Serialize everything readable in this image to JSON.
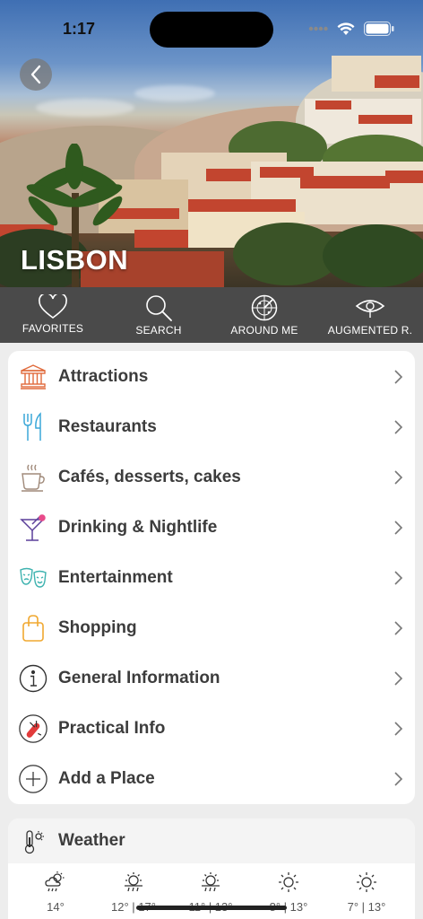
{
  "status": {
    "time": "1:17"
  },
  "hero": {
    "city": "LISBON"
  },
  "toolbar": {
    "items": [
      {
        "label": "FAVORITES",
        "icon": "heart-icon"
      },
      {
        "label": "SEARCH",
        "icon": "search-icon"
      },
      {
        "label": "AROUND ME",
        "icon": "radar-icon"
      },
      {
        "label": "AUGMENTED R.",
        "icon": "eye-icon"
      }
    ]
  },
  "menu": {
    "items": [
      {
        "label": "Attractions",
        "icon": "temple-icon",
        "color": "#e06a3b"
      },
      {
        "label": "Restaurants",
        "icon": "fork-knife-icon",
        "color": "#3aa7d8"
      },
      {
        "label": "Cafés, desserts, cakes",
        "icon": "coffee-cup-icon",
        "color": "#a08a7a"
      },
      {
        "label": "Drinking & Nightlife",
        "icon": "cocktail-icon",
        "color": "#5b3f9a"
      },
      {
        "label": "Entertainment",
        "icon": "theater-masks-icon",
        "color": "#3fb3b0"
      },
      {
        "label": "Shopping",
        "icon": "shopping-bag-icon",
        "color": "#f0a830"
      },
      {
        "label": "General Information",
        "icon": "info-icon",
        "color": "#333333"
      },
      {
        "label": "Practical Info",
        "icon": "swiss-knife-icon",
        "color": "#333333"
      },
      {
        "label": "Add a Place",
        "icon": "plus-circle-icon",
        "color": "#333333"
      }
    ]
  },
  "weather": {
    "title": "Weather",
    "days": [
      {
        "temp": "14°",
        "icon": "cloud-sun-rain-icon"
      },
      {
        "temp": "12° | 17°",
        "icon": "sun-rain-icon"
      },
      {
        "temp": "11° | 13°",
        "icon": "sun-rain-icon"
      },
      {
        "temp": "8° | 13°",
        "icon": "sun-icon"
      },
      {
        "temp": "7° | 13°",
        "icon": "sun-icon"
      }
    ]
  }
}
